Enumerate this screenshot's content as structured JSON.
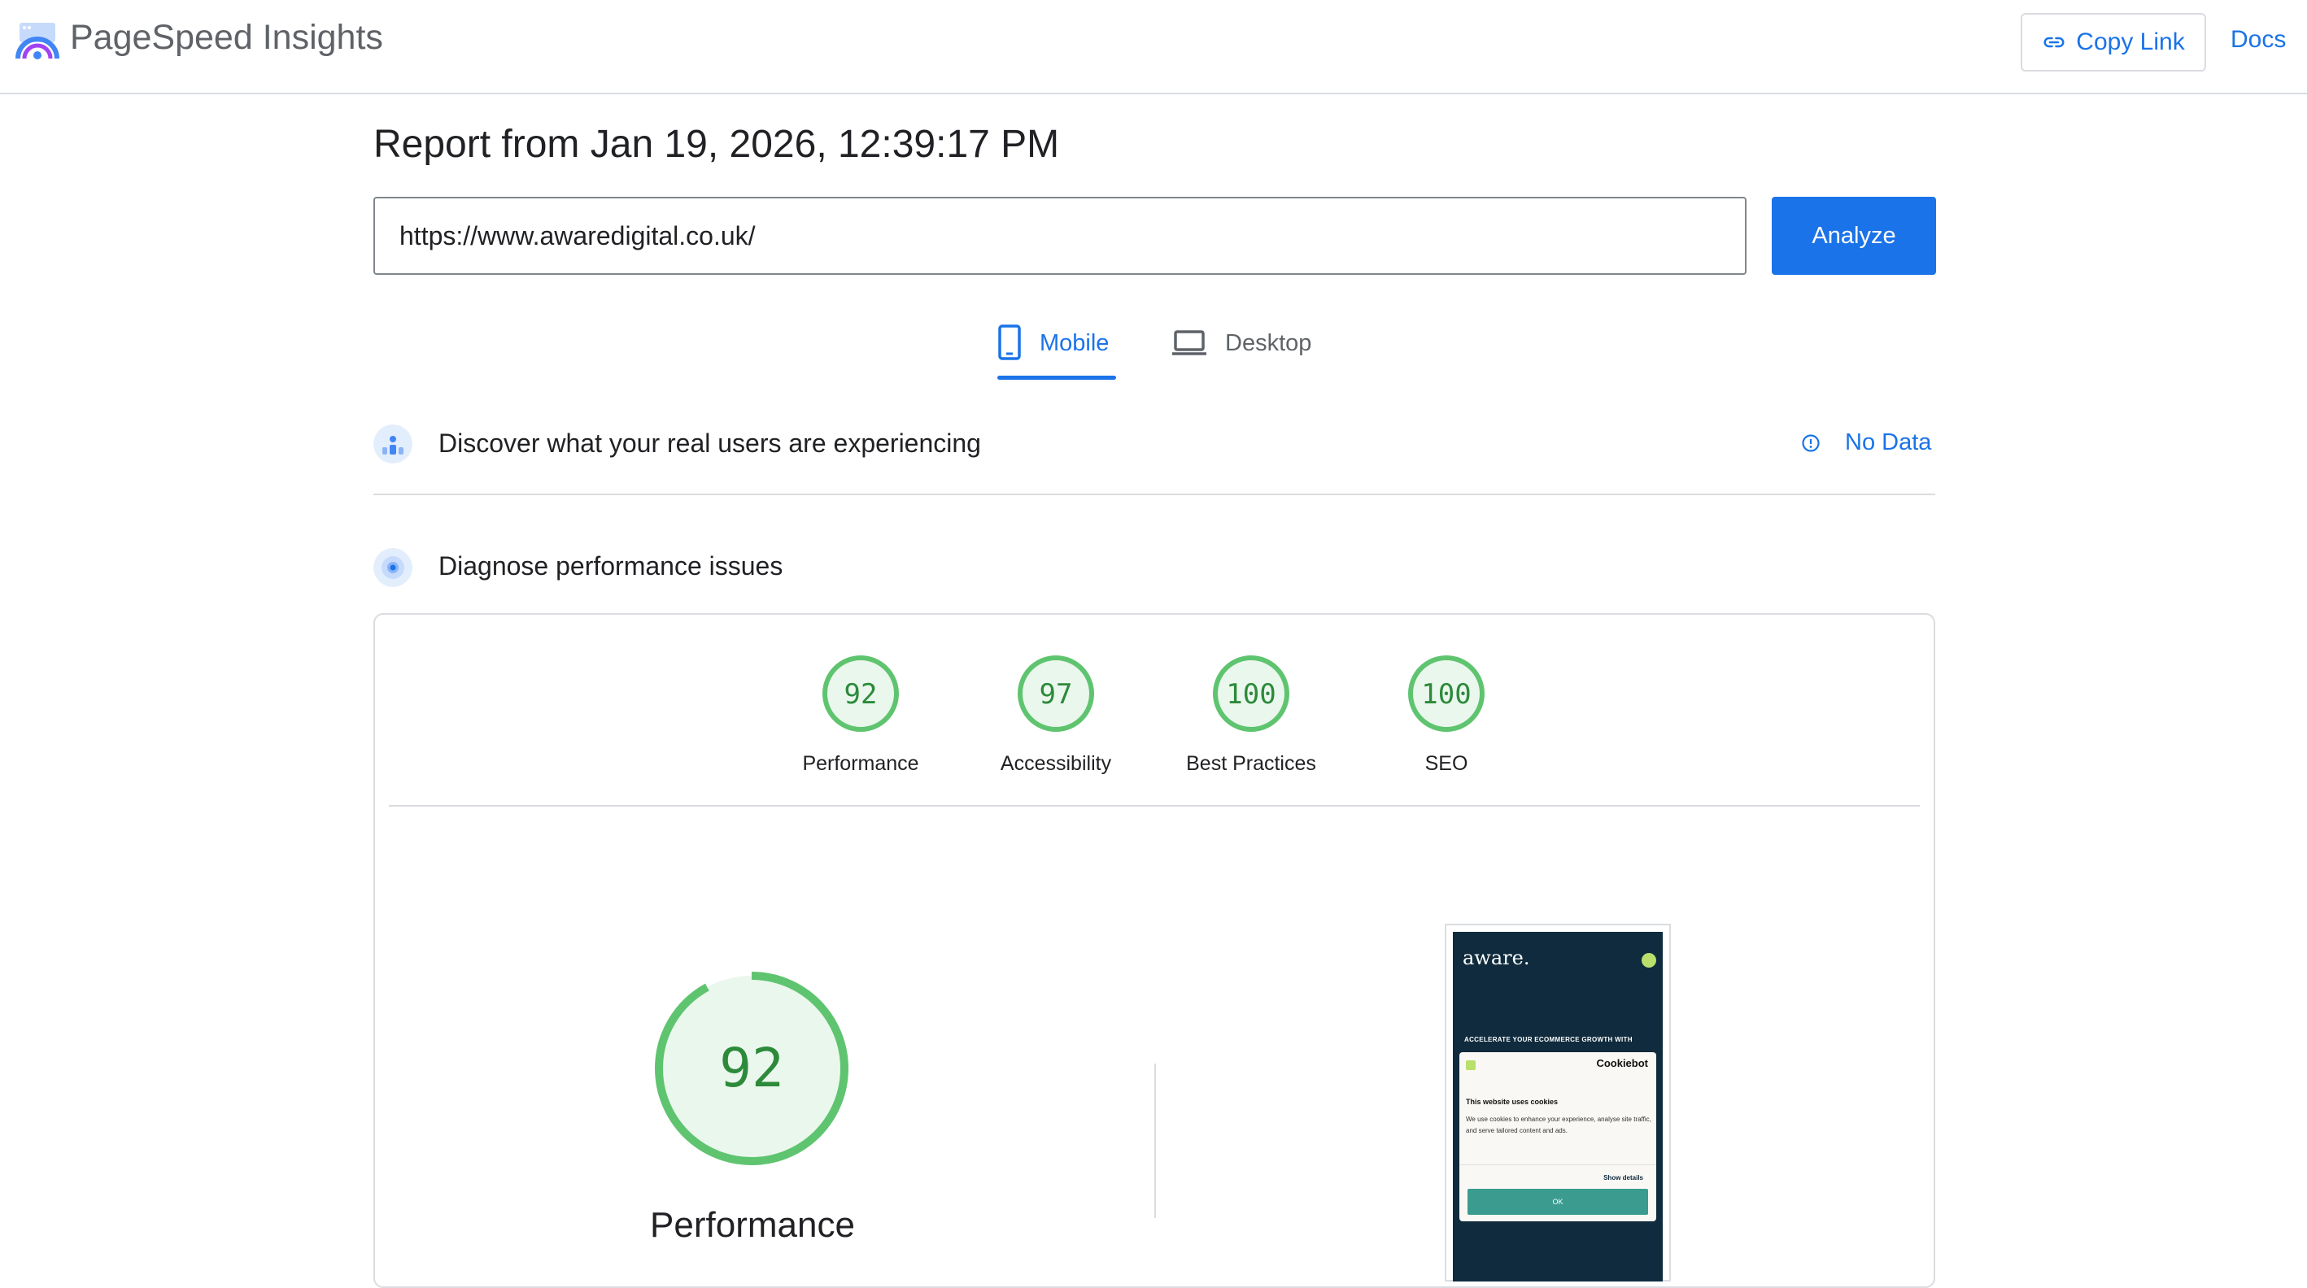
{
  "header": {
    "brand": "PageSpeed Insights",
    "copy_link_label": "Copy Link",
    "docs_label": "Docs"
  },
  "report": {
    "title": "Report from Jan 19, 2026, 12:39:17 PM",
    "url_value": "https://www.awaredigital.co.uk/",
    "analyze_label": "Analyze"
  },
  "tabs": [
    {
      "label": "Mobile",
      "active": true,
      "icon": "phone-icon"
    },
    {
      "label": "Desktop",
      "active": false,
      "icon": "laptop-icon"
    }
  ],
  "field_data": {
    "title": "Discover what your real users are experiencing",
    "status_label": "No Data",
    "icon": "users-icon"
  },
  "lab_data": {
    "title": "Diagnose performance issues",
    "icon": "radar-icon"
  },
  "scores": [
    {
      "value": "92",
      "label": "Performance"
    },
    {
      "value": "97",
      "label": "Accessibility"
    },
    {
      "value": "100",
      "label": "Best Practices"
    },
    {
      "value": "100",
      "label": "SEO"
    }
  ],
  "main_gauge": {
    "value": "92",
    "label": "Performance"
  },
  "screenshot": {
    "logo_text": "aware.",
    "tagline": "ACCELERATE YOUR ECOMMERCE GROWTH WITH",
    "cookie_brand": "Cookiebot",
    "cookie_title": "This website uses cookies",
    "cookie_body": "We use cookies to enhance your experience, analyse site traffic, and serve tailored content and ads.",
    "cookie_details": "Show details",
    "cookie_ok": "OK"
  },
  "colors": {
    "accent": "#1a73e8",
    "pass_green": "#0cce6b",
    "gauge_stroke": "#5fc46f",
    "gauge_fill": "#eaf7ed",
    "score_text": "#2c8a3a"
  }
}
